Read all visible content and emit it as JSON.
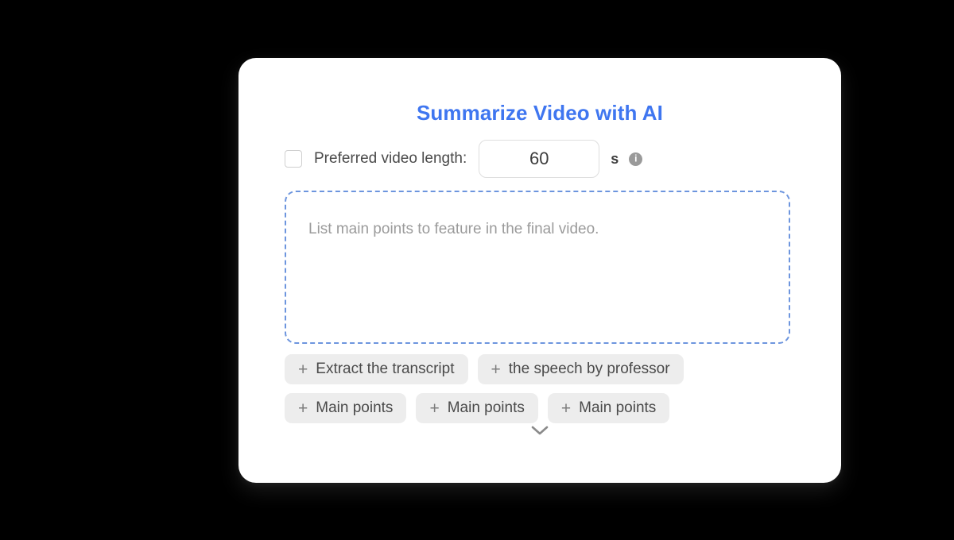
{
  "panel": {
    "title": "Summarize Video with AI"
  },
  "length_row": {
    "checkbox_checked": false,
    "label": "Preferred video length:",
    "value": "60",
    "placeholder": "60",
    "unit": "s",
    "info_icon": "info-icon",
    "info_glyph": "i"
  },
  "drop_area": {
    "placeholder": "List main points to feature in the final video.",
    "value": "",
    "border_color": "#6d95de"
  },
  "suggestions": {
    "plus_glyph": "+",
    "rows": [
      [
        {
          "label": "Extract the transcript"
        },
        {
          "label": "the speech by professor"
        }
      ],
      [
        {
          "label": "Main points"
        },
        {
          "label": "Main points"
        },
        {
          "label": "Main points"
        }
      ]
    ]
  },
  "expand": {
    "icon": "chevron-down-icon"
  },
  "colors": {
    "accent": "#3f76f0",
    "pill_bg": "#ededed",
    "text": "#4a4a4a",
    "muted": "#9b9b9b",
    "background": "#000000",
    "card": "#ffffff"
  }
}
